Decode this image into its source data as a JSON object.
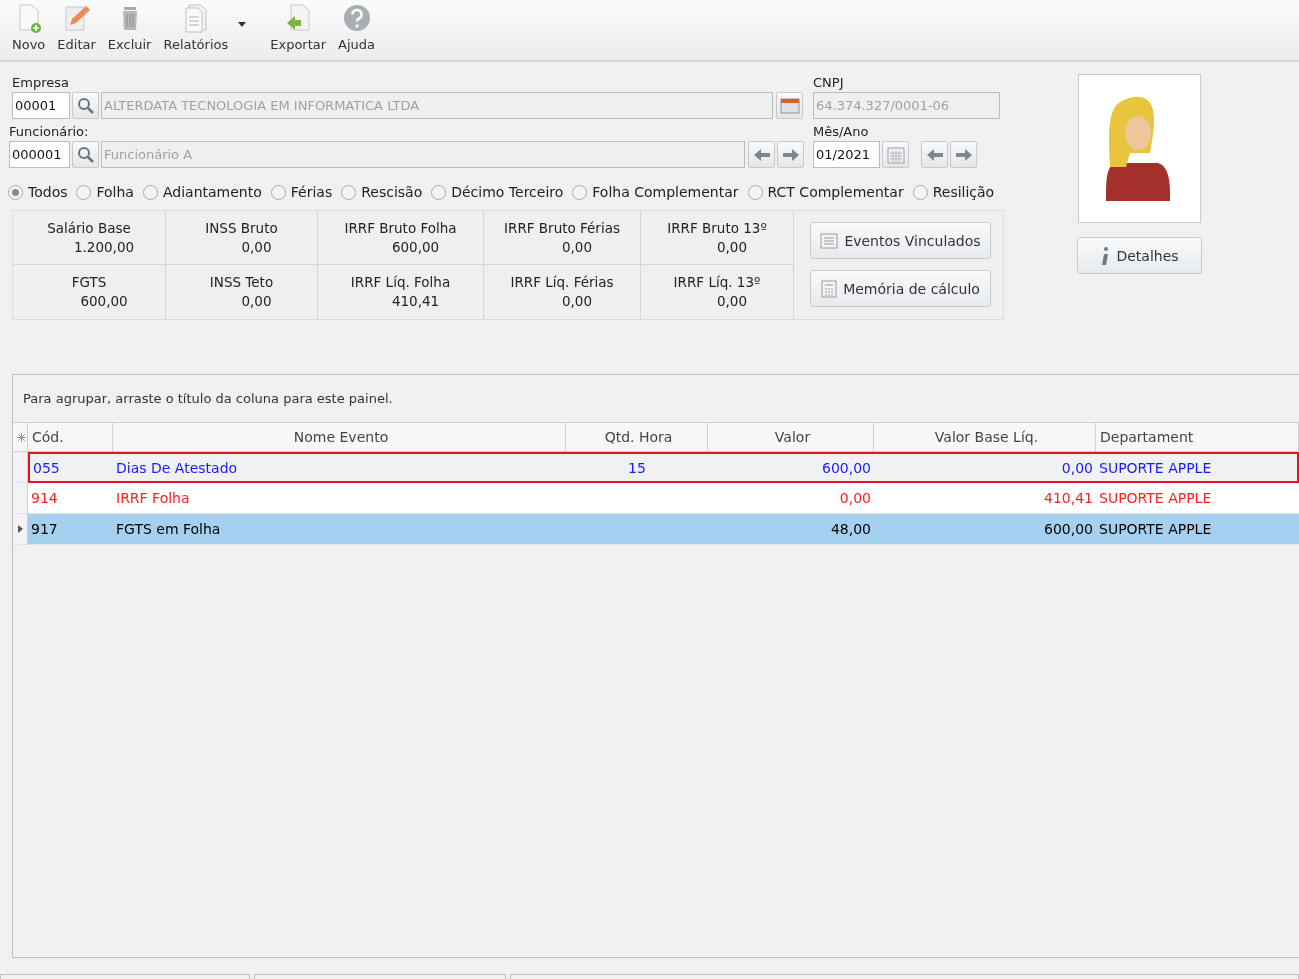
{
  "toolbar": [
    {
      "label": "Novo",
      "kind": "new"
    },
    {
      "label": "Editar",
      "kind": "edit"
    },
    {
      "label": "Excluir",
      "kind": "delete"
    },
    {
      "label": "Relatórios",
      "kind": "report"
    },
    {
      "label": "Exportar",
      "kind": "export"
    },
    {
      "label": "Ajuda",
      "kind": "help"
    }
  ],
  "empresa": {
    "label": "Empresa",
    "code": "00001",
    "name": "ALTERDATA TECNOLOGIA EM INFORMATICA LTDA"
  },
  "cnpj": {
    "label": "CNPJ",
    "value": "64.374.327/0001-06"
  },
  "funcionario": {
    "label": "Funcionário:",
    "code": "000001",
    "name": "Funcionário A"
  },
  "mes_ano": {
    "label": "Mês/Ano",
    "value": "01/2021"
  },
  "filters": [
    {
      "label": "Todos",
      "selected": true
    },
    {
      "label": "Folha",
      "selected": false
    },
    {
      "label": "Adiantamento",
      "selected": false
    },
    {
      "label": "Férias",
      "selected": false
    },
    {
      "label": "Rescisão",
      "selected": false
    },
    {
      "label": "Décimo Terceiro",
      "selected": false
    },
    {
      "label": "Folha Complementar",
      "selected": false
    },
    {
      "label": "RCT Complementar",
      "selected": false
    },
    {
      "label": "Resilição",
      "selected": false
    }
  ],
  "summary": [
    [
      {
        "label": "Salário Base",
        "value": "1.200,00"
      },
      {
        "label": "INSS Bruto",
        "value": "0,00"
      },
      {
        "label": "IRRF Bruto Folha",
        "value": "600,00"
      },
      {
        "label": "IRRF Bruto Férias",
        "value": "0,00"
      },
      {
        "label": "IRRF Bruto 13º",
        "value": "0,00"
      }
    ],
    [
      {
        "label": "FGTS",
        "value": "600,00"
      },
      {
        "label": "INSS Teto",
        "value": "0,00"
      },
      {
        "label": "IRRF Líq. Folha",
        "value": "410,41"
      },
      {
        "label": "IRRF Líq. Férias",
        "value": "0,00"
      },
      {
        "label": "IRRF Líq. 13º",
        "value": "0,00"
      }
    ]
  ],
  "summary_buttons": [
    "Eventos Vinculados",
    "Memória de cálculo"
  ],
  "details_button": "Detalhes",
  "grid": {
    "group_hint": "Para agrupar, arraste o título da coluna para este painel.",
    "columns": [
      "Cód.",
      "Nome Evento",
      "Qtd. Hora",
      "Valor",
      "Valor Base Líq.",
      "Departament"
    ],
    "rows": [
      {
        "cells": [
          "055",
          "Dias De Atestado",
          "15",
          "600,00",
          "0,00",
          "SUPORTE APPLE"
        ],
        "color": "#1a1aff",
        "selected": false,
        "highlighted": true
      },
      {
        "cells": [
          "914",
          "IRRF Folha",
          "",
          "0,00",
          "410,41",
          "SUPORTE APPLE"
        ],
        "color": "#ff2020",
        "selected": false,
        "highlighted": false
      },
      {
        "cells": [
          "917",
          "FGTS em Folha",
          "",
          "48,00",
          "600,00",
          "SUPORTE APPLE"
        ],
        "color": "#000000",
        "selected": true,
        "highlighted": false
      }
    ]
  }
}
